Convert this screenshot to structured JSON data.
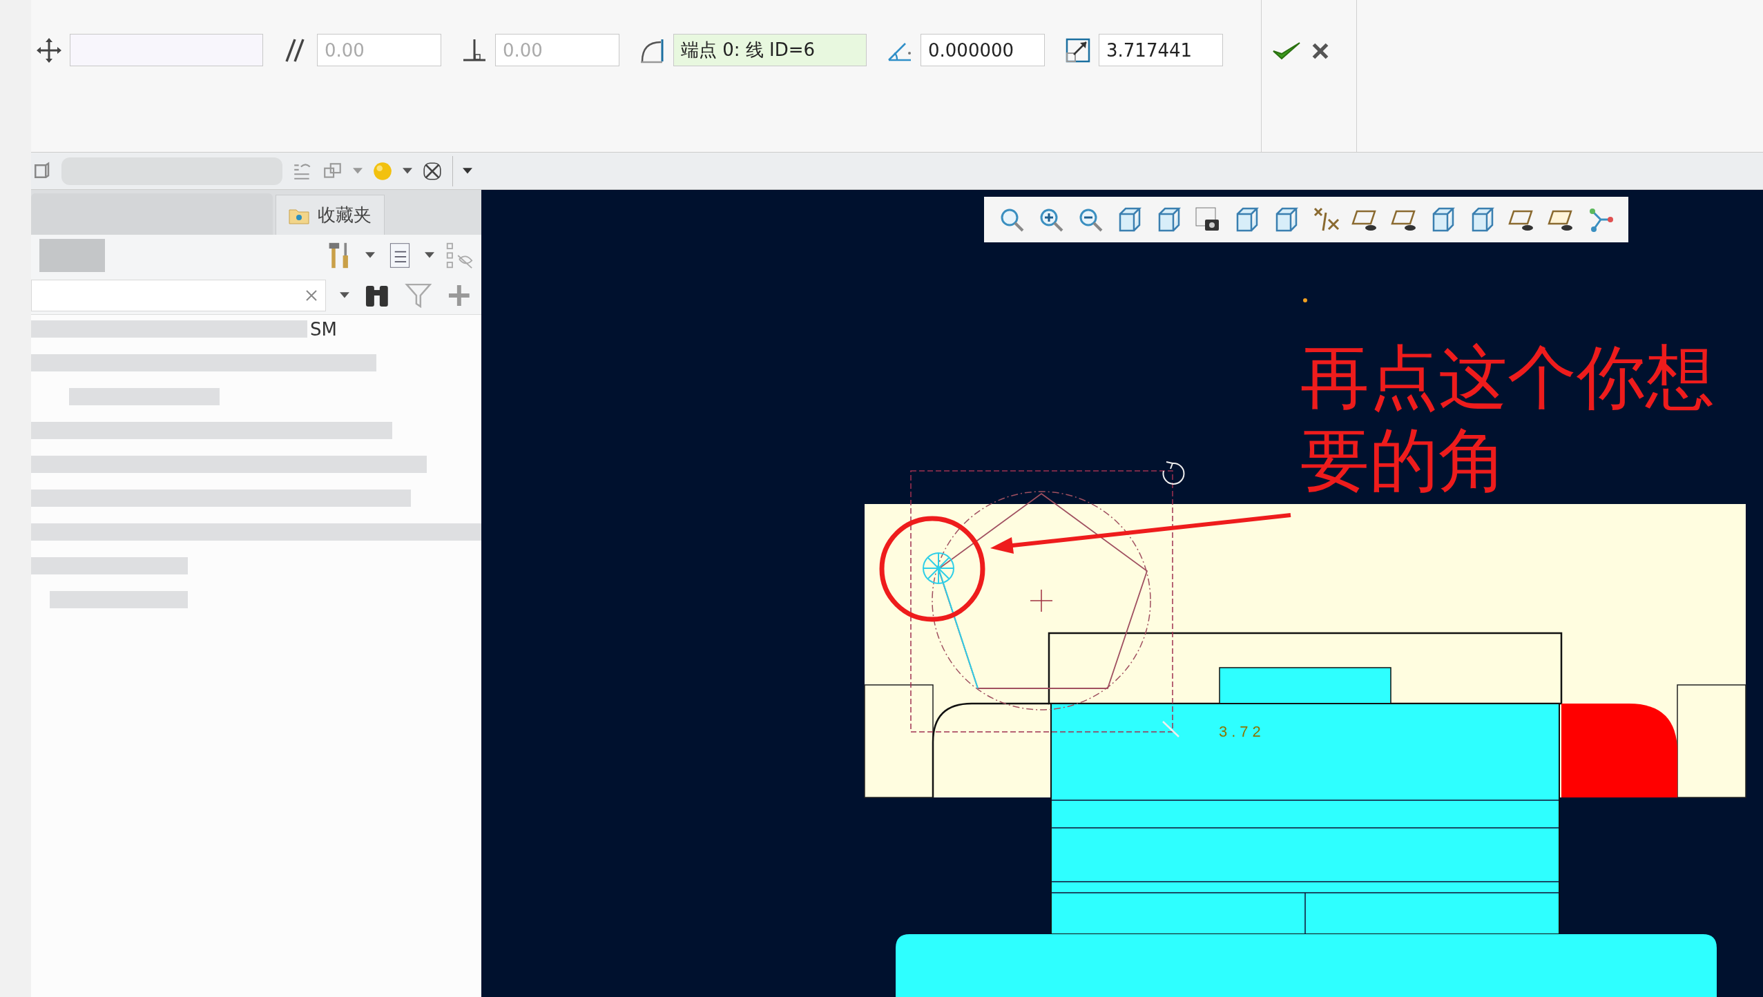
{
  "dashboard": {
    "fields": [
      {
        "kind": "move",
        "active": false
      },
      {
        "kind": "parallel",
        "placeholder": "0.00",
        "active": false
      },
      {
        "kind": "perpendicular",
        "placeholder": "0.00",
        "active": false
      },
      {
        "kind": "corner",
        "value": "端点 0: 线 ID=6",
        "active": true
      },
      {
        "kind": "angle",
        "value": "0.000000",
        "active": false
      },
      {
        "kind": "scale",
        "value": "3.717441",
        "active": false
      }
    ]
  },
  "model_tree": {
    "tabs": [
      {
        "label": "收藏夹",
        "selected": false
      }
    ],
    "tree_rows": [
      {
        "text": "SM"
      }
    ]
  },
  "graphics": {
    "dimension": "3.72",
    "annotation": "再点这个你想要的角"
  }
}
